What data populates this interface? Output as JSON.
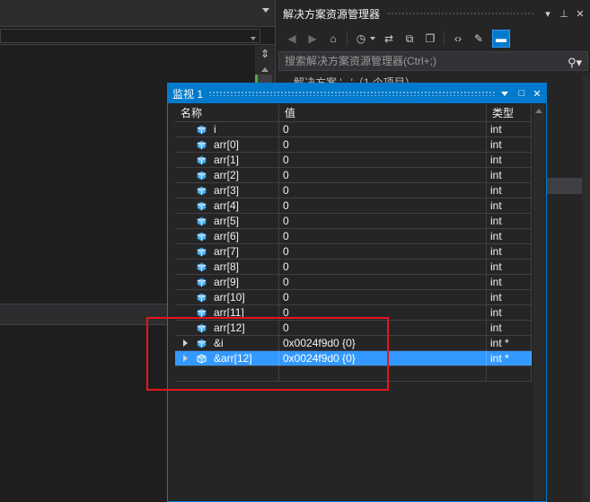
{
  "solution_explorer": {
    "title": "解决方案资源管理器",
    "search_placeholder": "搜索解决方案资源管理器(Ctrl+;)",
    "behind_text": "解决方案 '...'（1 个项目）"
  },
  "watch": {
    "title": "监视 1",
    "columns": {
      "name": "名称",
      "value": "值",
      "type": "类型"
    },
    "rows": [
      {
        "name": "i",
        "value": "0",
        "type": "int",
        "expandable": false
      },
      {
        "name": "arr[0]",
        "value": "0",
        "type": "int",
        "expandable": false
      },
      {
        "name": "arr[1]",
        "value": "0",
        "type": "int",
        "expandable": false
      },
      {
        "name": "arr[2]",
        "value": "0",
        "type": "int",
        "expandable": false
      },
      {
        "name": "arr[3]",
        "value": "0",
        "type": "int",
        "expandable": false
      },
      {
        "name": "arr[4]",
        "value": "0",
        "type": "int",
        "expandable": false
      },
      {
        "name": "arr[5]",
        "value": "0",
        "type": "int",
        "expandable": false
      },
      {
        "name": "arr[6]",
        "value": "0",
        "type": "int",
        "expandable": false
      },
      {
        "name": "arr[7]",
        "value": "0",
        "type": "int",
        "expandable": false
      },
      {
        "name": "arr[8]",
        "value": "0",
        "type": "int",
        "expandable": false
      },
      {
        "name": "arr[9]",
        "value": "0",
        "type": "int",
        "expandable": false
      },
      {
        "name": "arr[10]",
        "value": "0",
        "type": "int",
        "expandable": false
      },
      {
        "name": "arr[11]",
        "value": "0",
        "type": "int",
        "expandable": false
      },
      {
        "name": "arr[12]",
        "value": "0",
        "type": "int",
        "expandable": false
      },
      {
        "name": "&i",
        "value": "0x0024f9d0 {0}",
        "type": "int *",
        "expandable": true
      },
      {
        "name": "&arr[12]",
        "value": "0x0024f9d0 {0}",
        "type": "int *",
        "expandable": true,
        "selected": true
      }
    ]
  },
  "colors": {
    "accent": "#007acc",
    "selection": "#3399ff",
    "highlight_box": "#e8141c",
    "variable_icon": "#5ab4f0"
  }
}
